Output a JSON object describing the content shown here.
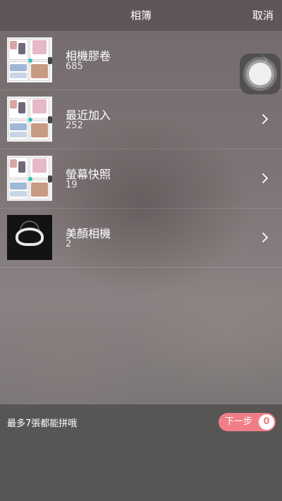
{
  "header": {
    "title": "相簿",
    "cancel_label": "取消"
  },
  "albums": [
    {
      "name": "相機膠卷",
      "count": "685",
      "thumbnail": "collage-thumbnail"
    },
    {
      "name": "最近加入",
      "count": "252",
      "thumbnail": "collage-thumbnail"
    },
    {
      "name": "螢幕快照",
      "count": "19",
      "thumbnail": "collage-thumbnail"
    },
    {
      "name": "美顏相機",
      "count": "2",
      "thumbnail": "dark-photo-thumbnail"
    }
  ],
  "icons": {
    "row_chevron": "chevron-right-icon",
    "floating": "assistive-touch-icon"
  },
  "footer": {
    "hint": "最多7張都能拼哦",
    "next_label": "下一步",
    "selected_count": "0"
  },
  "colors": {
    "accent": "#f07e88",
    "footer_bg": "#585555",
    "header_bg": "#5c5253"
  }
}
